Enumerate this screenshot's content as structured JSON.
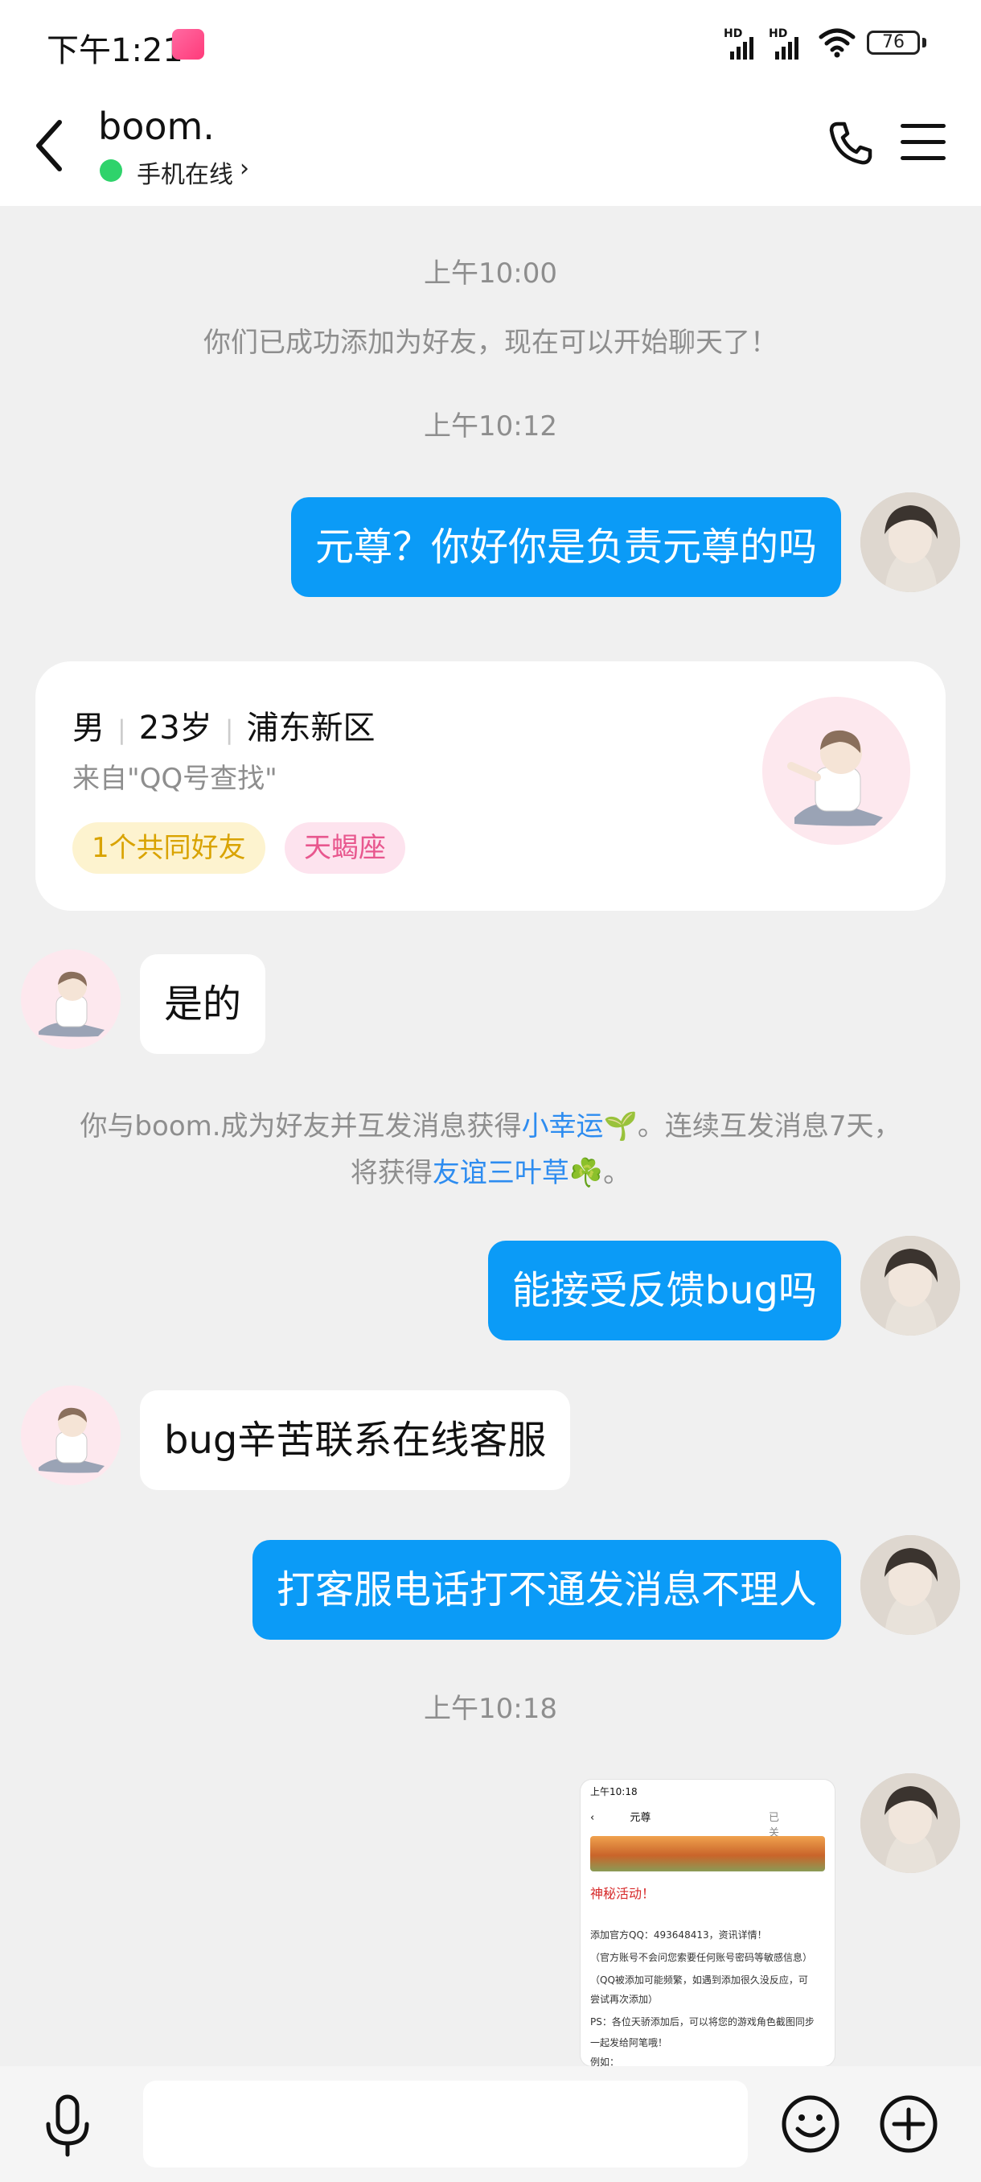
{
  "status_bar": {
    "time": "下午1:21",
    "signal1_label": "HD",
    "signal2_label": "HD",
    "battery": "76"
  },
  "header": {
    "contact_name": "boom.",
    "online_status": "手机在线",
    "chevron": "›"
  },
  "chat": {
    "timestamps": [
      "上午10:00",
      "上午10:12",
      "上午10:18"
    ],
    "system_added": "你们已成功添加为好友，现在可以开始聊天了！",
    "messages": [
      {
        "side": "out",
        "text": "元尊？你好你是负责元尊的吗"
      },
      {
        "side": "in",
        "text": "是的"
      },
      {
        "side": "out",
        "text": "能接受反馈bug吗"
      },
      {
        "side": "in",
        "text": "bug辛苦联系在线客服"
      },
      {
        "side": "out",
        "text": "打客服电话打不通发消息不理人"
      }
    ],
    "luck_notice": {
      "part1": "你与boom.成为好友并互发消息获得",
      "link1": "小幸运🌱",
      "part2": "。连续互发消息7天，",
      "part3": "将获得",
      "link2": "友谊三叶草☘️",
      "part4": "。"
    }
  },
  "profile_card": {
    "gender": "男",
    "age": "23岁",
    "location": "浦东新区",
    "source": "来自\"QQ号查找\"",
    "tags": [
      "1个共同好友",
      "天蝎座"
    ]
  },
  "screenshot_thumb": {
    "time": "上午10:18",
    "title": "元尊",
    "follow": "已关注",
    "headline": "神秘活动！",
    "lines": [
      "添加官方QQ：493648413，资讯详情！",
      "（官方账号不会问您索要任何账号密码等敏感信息）",
      "（QQ被添加可能频繁，如遇到添加很久没反应，可",
      "尝试再次添加）",
      "PS：各位天骄添加后，可以将您的游戏角色截图同步",
      "一起发给阿笔哦！",
      "例如："
    ]
  },
  "colors": {
    "outgoing_bubble": "#0b9bf7",
    "incoming_bubble": "#ffffff",
    "link": "#2d8cf0",
    "online": "#2fd36b"
  },
  "icons": [
    "back-arrow-icon",
    "phone-icon",
    "menu-icon",
    "microphone-icon",
    "emoji-icon",
    "plus-icon"
  ]
}
